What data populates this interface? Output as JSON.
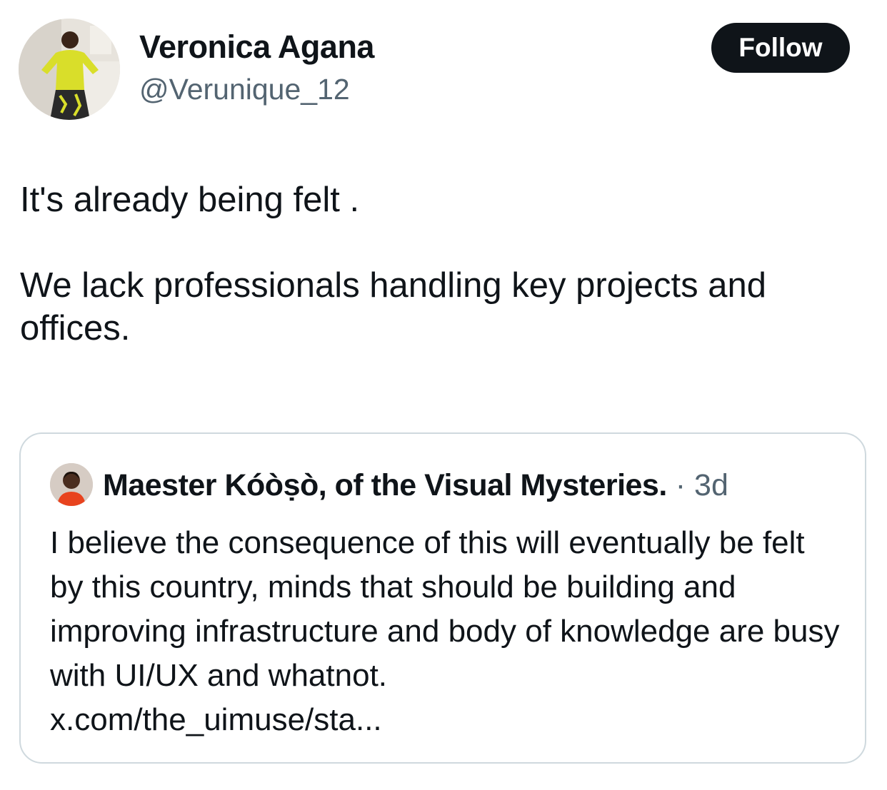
{
  "author": {
    "display_name": "Veronica Agana",
    "handle": "@Verunique_12",
    "avatar_icon": "user-avatar-photo"
  },
  "follow_button": {
    "label": "Follow"
  },
  "tweet": {
    "paragraph_1": "It's already being felt .",
    "paragraph_2": "We lack professionals handling key projects and offices."
  },
  "quoted_tweet": {
    "author_name": "Maester Kóòṣò, of the Visual Mysteries.",
    "separator": "·",
    "time": "3d",
    "avatar_icon": "quoted-user-avatar-photo",
    "text": "I believe the consequence of this will eventually be felt by this country, minds that should be building and improving infrastructure and body of knowledge are busy with UI/UX and whatnot.",
    "link": "x.com/the_uimuse/sta..."
  },
  "colors": {
    "text_primary": "#0f1419",
    "text_secondary": "#536471",
    "border": "#cfd9de",
    "follow_bg": "#0f1419",
    "follow_text": "#ffffff"
  }
}
